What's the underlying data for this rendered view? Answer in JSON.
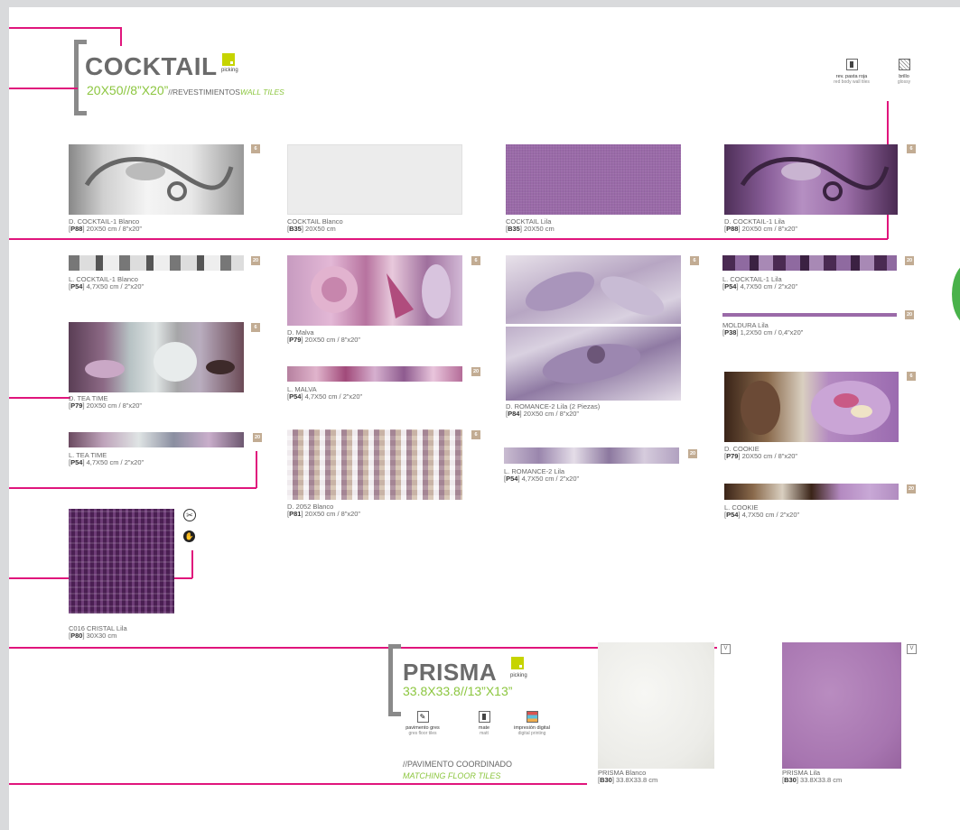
{
  "header": {
    "title": "COCKTAIL",
    "picking": "picking",
    "size": "20X50//8”X20”",
    "category_es": "//REVESTIMIENTOS",
    "category_en": "WALL TILES"
  },
  "features": [
    {
      "icon": "red-body-tile-icon",
      "label_es": "rev. pasta roja",
      "label_en": "red body wall tiles"
    },
    {
      "icon": "glossy-icon",
      "label_es": "brillo",
      "label_en": "glossy"
    }
  ],
  "products": {
    "d_cocktail_blanco": {
      "name": "D. COCKTAIL-1 Blanco",
      "code": "P88",
      "size": "20X50 cm / 8”x20”",
      "badge": "6"
    },
    "cocktail_blanco": {
      "name": "COCKTAIL Blanco",
      "code": "B35",
      "size": "20X50 cm"
    },
    "cocktail_lila": {
      "name": "COCKTAIL Lila",
      "code": "B35",
      "size": "20X50 cm"
    },
    "d_cocktail_lila": {
      "name": "D. COCKTAIL-1 Lila",
      "code": "P88",
      "size": "20X50 cm / 8”x20”",
      "badge": "6"
    },
    "l_cocktail_blanco": {
      "name": "L. COCKTAIL-1 Blanco",
      "code": "P54",
      "size": "4,7X50 cm / 2”x20”",
      "badge": "20"
    },
    "d_malva": {
      "name": "D. Malva",
      "code": "P79",
      "size": "20X50 cm / 8”x20”",
      "badge": "6"
    },
    "d_romance": {
      "name": "D. ROMANCE-2 Lila (2 Piezas)",
      "code": "P84",
      "size": "20X50 cm / 8”x20”",
      "badge": "6"
    },
    "l_cocktail_lila": {
      "name": "L. COCKTAIL-1 Lila",
      "code": "P54",
      "size": "4,7X50 cm / 2”x20”",
      "badge": "20"
    },
    "moldura_lila": {
      "name": "MOLDURA Lila",
      "code": "P38",
      "size": "1,2X50 cm / 0,4”x20”",
      "badge": "20"
    },
    "d_tea_time": {
      "name": "D. TEA TIME",
      "code": "P79",
      "size": "20X50 cm / 8”x20”",
      "badge": "6"
    },
    "l_malva": {
      "name": "L. MALVA",
      "code": "P54",
      "size": "4,7X50 cm / 2”x20”",
      "badge": "20"
    },
    "l_romance": {
      "name": "L. ROMANCE-2 Lila",
      "code": "P54",
      "size": "4,7X50 cm / 2”x20”",
      "badge": "20"
    },
    "d_cookie": {
      "name": "D. COOKIE",
      "code": "P79",
      "size": "20X50 cm / 8”x20”",
      "badge": "6"
    },
    "l_tea_time": {
      "name": "L. TEA TIME",
      "code": "P54",
      "size": "4,7X50 cm / 2”x20”",
      "badge": "20"
    },
    "d_2052": {
      "name": "D. 2052 Blanco",
      "code": "P81",
      "size": "20X50 cm / 8”x20”",
      "badge": "6"
    },
    "l_cookie": {
      "name": "L. COOKIE",
      "code": "P54",
      "size": "4,7X50 cm / 2”x20”",
      "badge": "20"
    },
    "c016_cristal": {
      "name": "C016 CRISTAL Lila",
      "code": "P80",
      "size": "30X30 cm"
    }
  },
  "prisma": {
    "title": "PRISMA",
    "picking": "picking",
    "size": "33.8X33.8//13”X13”",
    "features": [
      {
        "icon": "floor-tile-icon",
        "label_es": "pavimento gres",
        "label_en": "gres floor tiles"
      },
      {
        "icon": "matt-icon",
        "label_es": "mate",
        "label_en": "matt"
      },
      {
        "icon": "digital-print-icon",
        "label_es": "impresión digital",
        "label_en": "digital printing"
      }
    ],
    "coord_es": "//PAVIMENTO COORDINADO",
    "coord_en": "MATCHING FLOOR TILES",
    "items": {
      "blanco": {
        "name": "PRISMA Blanco",
        "code": "B30",
        "size": "33.8X33.8 cm",
        "badge": "V"
      },
      "lila": {
        "name": "PRISMA Lila",
        "code": "B30",
        "size": "33.8X33.8 cm",
        "badge": "V"
      }
    }
  },
  "colors": {
    "accent_line": "#e0157c",
    "green": "#8cc63f",
    "badge": "#c2ac93"
  }
}
